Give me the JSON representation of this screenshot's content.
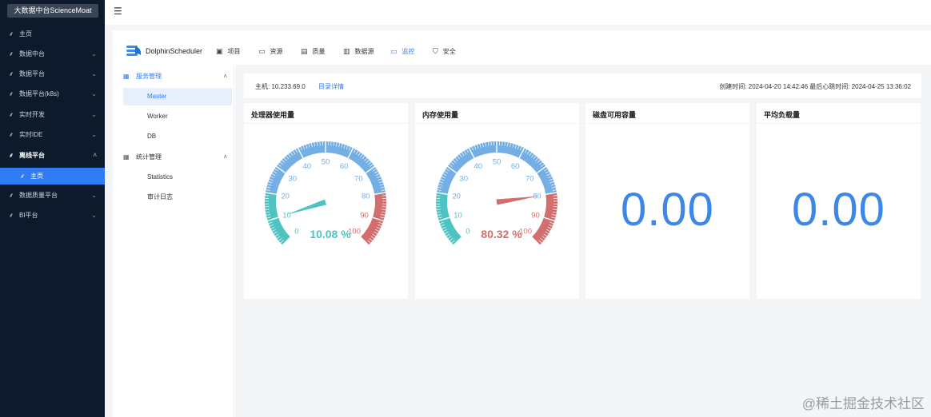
{
  "brand": "大数据中台ScienceMoat",
  "sidebar": {
    "items": [
      {
        "label": "主页",
        "chevron": false
      },
      {
        "label": "数据中台",
        "chevron": true
      },
      {
        "label": "数据平台",
        "chevron": true
      },
      {
        "label": "数据平台(k8s)",
        "chevron": true
      },
      {
        "label": "实时开发",
        "chevron": true
      },
      {
        "label": "实时IDE",
        "chevron": true
      },
      {
        "label": "离线平台",
        "chevron": true,
        "open": true
      },
      {
        "label": "主页",
        "active": true
      },
      {
        "label": "数据质量平台",
        "chevron": true
      },
      {
        "label": "BI平台",
        "chevron": true
      }
    ]
  },
  "header": {
    "menu_icon": "☰"
  },
  "app": {
    "logo_text": "DolphinScheduler",
    "nav": [
      {
        "label": "项目",
        "icon": "project-icon"
      },
      {
        "label": "资源",
        "icon": "folder-icon"
      },
      {
        "label": "质量",
        "icon": "document-icon"
      },
      {
        "label": "数据源",
        "icon": "database-icon"
      },
      {
        "label": "监控",
        "icon": "monitor-icon",
        "active": true
      },
      {
        "label": "安全",
        "icon": "shield-icon"
      }
    ],
    "sub_menu": {
      "group1": "服务管理",
      "group1_items": [
        "Master",
        "Worker",
        "DB"
      ],
      "group2": "统计管理",
      "group2_items": [
        "Statistics",
        "审计日志"
      ]
    }
  },
  "info": {
    "host": "主机: 10.233.69.0",
    "detail_link": "目录详情",
    "times": "创建时间: 2024-04-20 14:42:46     最后心跳时间: 2024-04-25 13:36:02"
  },
  "cards": [
    {
      "title": "处理器使用量",
      "value": 10.08,
      "value_text": "10.08 %",
      "color": "#4fc2c2"
    },
    {
      "title": "内存使用量",
      "value": 80.32,
      "value_text": "80.32 %",
      "color": "#d26e6e"
    },
    {
      "title": "磁盘可用容量",
      "big_text": "0.00"
    },
    {
      "title": "平均负载量",
      "big_text": "0.00"
    }
  ],
  "gauge_ticks": [
    "0",
    "10",
    "20",
    "30",
    "40",
    "50",
    "60",
    "70",
    "80",
    "90",
    "100"
  ],
  "watermark": "@稀土掘金技术社区",
  "colors": {
    "sidebar_bg": "#0c1a2b",
    "accent": "#2f7cf6",
    "gauge_low": "#4fc2c2",
    "gauge_mid": "#73aee5",
    "gauge_high": "#d26e6e"
  }
}
